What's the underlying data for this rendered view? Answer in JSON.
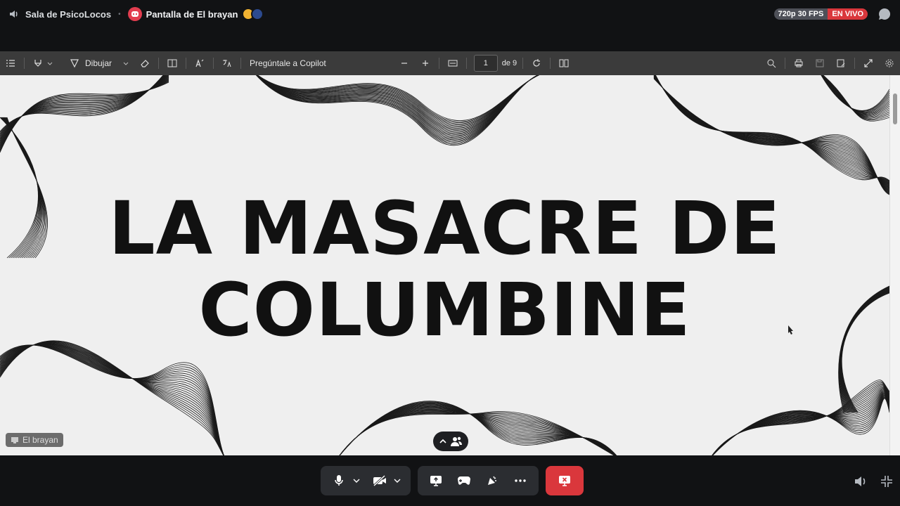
{
  "topbar": {
    "channel_name": "Sala de PsicoLocos",
    "separator": "•",
    "stream_title": "Pantalla de El brayan",
    "quality": "720p 30 FPS",
    "live_label": "EN VIVO"
  },
  "pdf_toolbar": {
    "draw_label": "Dibujar",
    "copilot_label": "Pregúntale a Copilot",
    "page_current": "1",
    "page_total": "de 9"
  },
  "slide": {
    "title_line1": "LA MASACRE DE",
    "title_line2": "COLUMBINE"
  },
  "stream_overlay": {
    "streamer_name": "El brayan"
  },
  "colors": {
    "live": "#da373c",
    "background": "#111214",
    "toolbar": "#3b3b3b"
  }
}
